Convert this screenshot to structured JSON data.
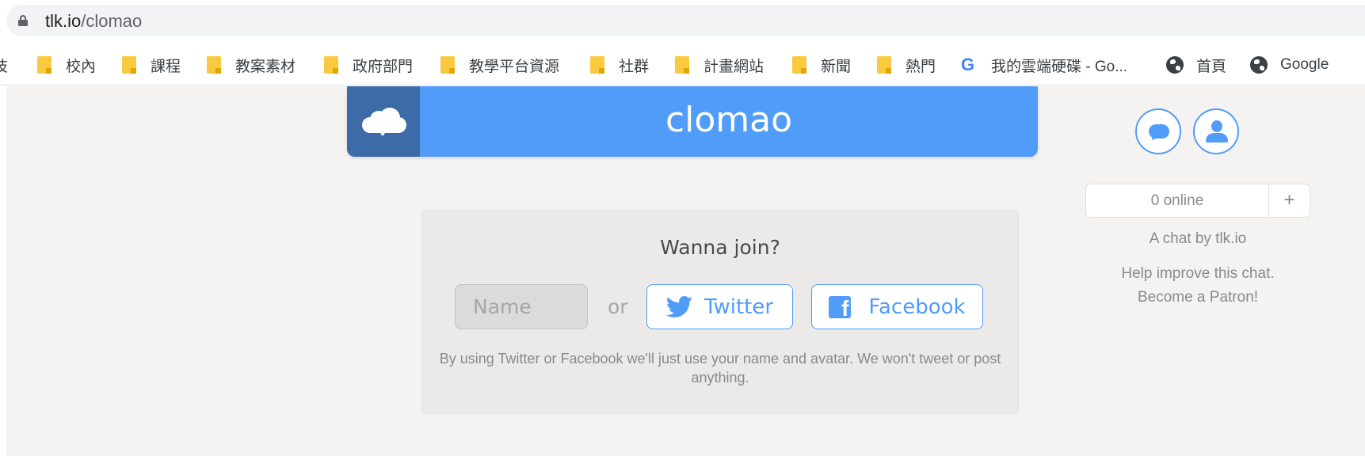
{
  "browser": {
    "url_host": "tlk.io",
    "url_path": "/clomao"
  },
  "bookmarks": [
    {
      "label": "技",
      "icon": "folder-icon"
    },
    {
      "label": "校內",
      "icon": "folder-icon"
    },
    {
      "label": "課程",
      "icon": "folder-icon"
    },
    {
      "label": "教案素材",
      "icon": "folder-icon"
    },
    {
      "label": "政府部門",
      "icon": "folder-icon"
    },
    {
      "label": "教學平台資源",
      "icon": "folder-icon"
    },
    {
      "label": "社群",
      "icon": "folder-icon"
    },
    {
      "label": "計畫網站",
      "icon": "folder-icon"
    },
    {
      "label": "新聞",
      "icon": "folder-icon"
    },
    {
      "label": "熱門",
      "icon": "folder-icon"
    },
    {
      "label": "我的雲端硬碟 - Go...",
      "icon": "google-icon"
    },
    {
      "label": "首頁",
      "icon": "globe-icon"
    },
    {
      "label": "Google",
      "icon": "globe-icon"
    }
  ],
  "header": {
    "title": "clomao",
    "logo_icon": "cloud-chat-icon"
  },
  "sidebar": {
    "chat_button_icon": "chat-bubble-icon",
    "profile_button_icon": "user-icon",
    "online_count": "0 online",
    "add_label": "+",
    "credit": "A chat by tlk.io",
    "help_line1": "Help improve this chat.",
    "help_line2": "Become a Patron!"
  },
  "join": {
    "title": "Wanna join?",
    "name_placeholder": "Name",
    "or_label": "or",
    "twitter_label": "Twitter",
    "facebook_label": "Facebook",
    "disclaimer": "By using Twitter or Facebook we'll just use your name and avatar. We won't tweet or post anything."
  },
  "colors": {
    "accent": "#519cf8",
    "logo_bg": "#3c6ba8",
    "page_bg": "#f4f3f2",
    "card_bg": "#ebeae9",
    "bookmark_folder": "#f9c940"
  }
}
